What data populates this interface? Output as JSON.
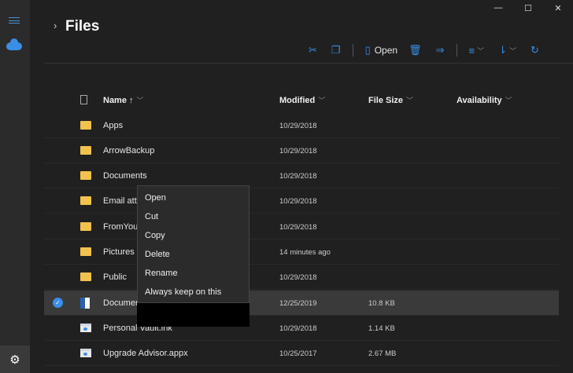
{
  "window": {
    "controls": [
      "—",
      "☐",
      "✕"
    ]
  },
  "header": {
    "title": "Files",
    "breadcrumb_chevron": "›"
  },
  "toolbar": {
    "open_label": "Open",
    "icons": [
      "cut-icon",
      "copy-icon",
      "open-icon",
      "delete-icon",
      "share-icon",
      "view-options-icon",
      "sort-icon",
      "refresh-icon"
    ]
  },
  "columns": {
    "name": "Name ↑",
    "modified": "Modified",
    "size": "File Size",
    "availability": "Availability"
  },
  "rows": [
    {
      "name": "Apps",
      "modified": "10/29/2018",
      "size": "",
      "type": "folder"
    },
    {
      "name": "ArrowBackup",
      "modified": "10/29/2018",
      "size": "",
      "type": "folder"
    },
    {
      "name": "Documents",
      "modified": "10/29/2018",
      "size": "",
      "type": "folder"
    },
    {
      "name": "Email atta",
      "modified": "10/29/2018",
      "size": "",
      "type": "folder"
    },
    {
      "name": "FromYour",
      "modified": "10/29/2018",
      "size": "",
      "type": "folder"
    },
    {
      "name": "Pictures",
      "modified": "14 minutes ago",
      "size": "",
      "type": "folder"
    },
    {
      "name": "Public",
      "modified": "10/29/2018",
      "size": "",
      "type": "folder"
    },
    {
      "name": "Documen",
      "modified": "12/25/2019",
      "size": "10.8 KB",
      "type": "word",
      "selected": true
    },
    {
      "name": "Personal Vault.lnk",
      "modified": "10/29/2018",
      "size": "1.14 KB",
      "type": "lnk"
    },
    {
      "name": "Upgrade Advisor.appx",
      "modified": "10/25/2017",
      "size": "2.67 MB",
      "type": "lnk"
    }
  ],
  "context_menu": [
    "Open",
    "Cut",
    "Copy",
    "Delete",
    "Rename",
    "Always keep on this device"
  ],
  "colors": {
    "accent": "#3a8ee6",
    "folder": "#f2c14e",
    "background": "#202020"
  }
}
